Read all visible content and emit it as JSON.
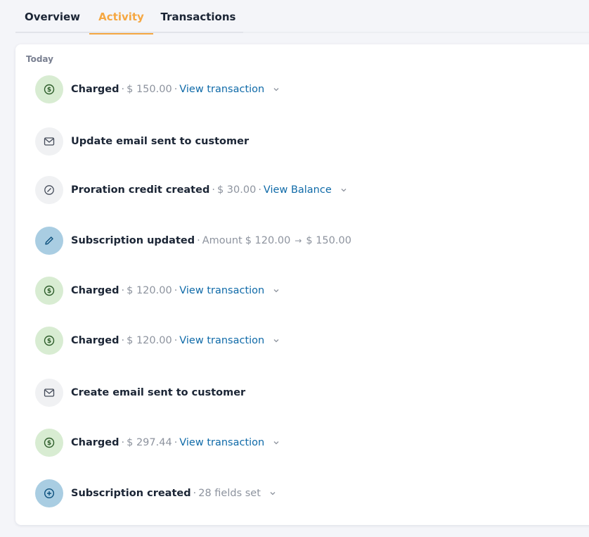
{
  "tabs": [
    {
      "label": "Overview"
    },
    {
      "label": "Activity"
    },
    {
      "label": "Transactions"
    }
  ],
  "activity": {
    "group_label": "Today",
    "items": [
      {
        "title": "Charged",
        "amount": "$ 150.00",
        "link": "View transaction"
      },
      {
        "title": "Update email sent to customer"
      },
      {
        "title": "Proration credit created",
        "amount": "$ 30.00",
        "link": "View Balance"
      },
      {
        "title": "Subscription updated",
        "prefix": "Amount",
        "from": "$ 120.00",
        "to": "$ 150.00"
      },
      {
        "title": "Charged",
        "amount": "$ 120.00",
        "link": "View transaction"
      },
      {
        "title": "Charged",
        "amount": "$ 120.00",
        "link": "View transaction"
      },
      {
        "title": "Create email sent to customer"
      },
      {
        "title": "Charged",
        "amount": "$ 297.44",
        "link": "View transaction"
      },
      {
        "title": "Subscription created",
        "detail": "28 fields set"
      }
    ]
  },
  "colors": {
    "accent": "#f5a742",
    "link": "#0f6aa8",
    "charge_icon_bg": "#d8ecd2",
    "neutral_icon_bg": "#f0f1f3",
    "subscription_icon_bg": "#a9cde2"
  }
}
